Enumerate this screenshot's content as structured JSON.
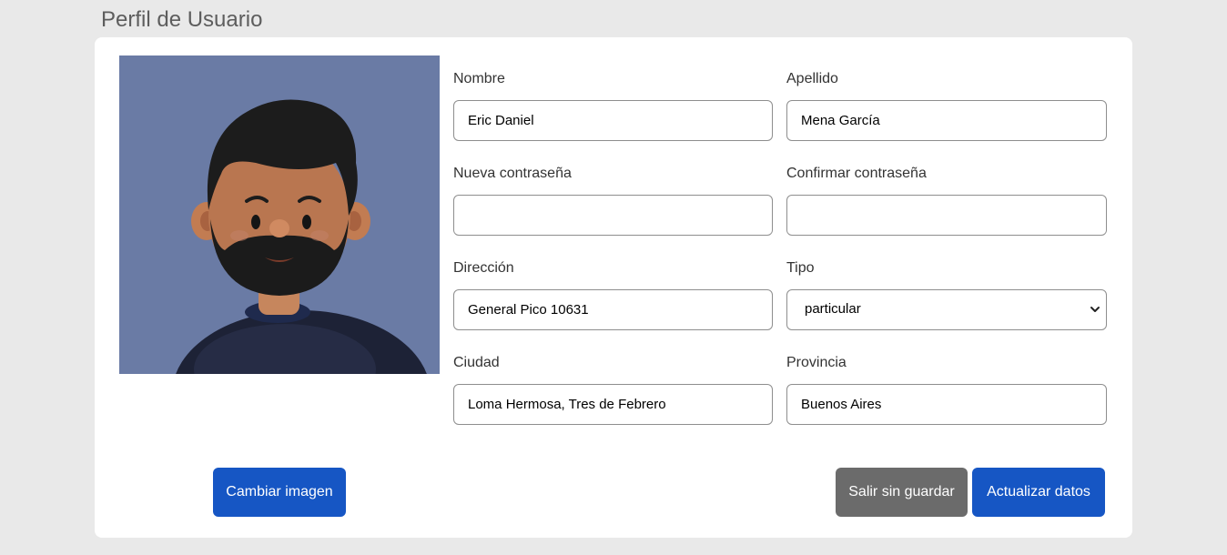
{
  "page": {
    "title": "Perfil de Usuario"
  },
  "avatar": {
    "icon": "user-avatar-illustration",
    "background_color": "#6a7ba5"
  },
  "form": {
    "nombre": {
      "label": "Nombre",
      "value": "Eric Daniel"
    },
    "apellido": {
      "label": "Apellido",
      "value": "Mena García"
    },
    "nueva_contrasena": {
      "label": "Nueva contraseña",
      "value": ""
    },
    "confirmar_contrasena": {
      "label": "Confirmar contraseña",
      "value": ""
    },
    "direccion": {
      "label": "Dirección",
      "value": "General Pico 10631"
    },
    "tipo": {
      "label": "Tipo",
      "value": "particular"
    },
    "ciudad": {
      "label": "Ciudad",
      "value": "Loma Hermosa, Tres de Febrero"
    },
    "provincia": {
      "label": "Provincia",
      "value": "Buenos Aires"
    }
  },
  "buttons": {
    "change_image": "Cambiar imagen",
    "exit_without_saving": "Salir sin guardar",
    "update_data": "Actualizar datos"
  },
  "colors": {
    "primary": "#1656c4",
    "secondary": "#6b6b6b",
    "page_background": "#e9e9e9"
  }
}
